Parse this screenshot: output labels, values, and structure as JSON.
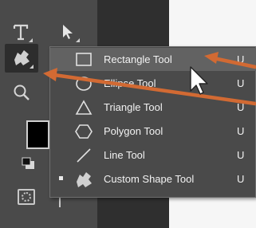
{
  "toolbar": {
    "tools": [
      "type-tool",
      "path-selection-tool",
      "custom-shape-tool",
      "zoom-tool",
      "foreground-color",
      "default-colors",
      "quick-mask",
      "screen-mode"
    ]
  },
  "shape_menu": {
    "items": [
      {
        "label": "Rectangle Tool",
        "shortcut": "U",
        "icon": "rectangle-icon",
        "active": false,
        "highlighted": true
      },
      {
        "label": "Ellipse Tool",
        "shortcut": "U",
        "icon": "ellipse-icon",
        "active": false,
        "highlighted": false
      },
      {
        "label": "Triangle Tool",
        "shortcut": "U",
        "icon": "triangle-icon",
        "active": false,
        "highlighted": false
      },
      {
        "label": "Polygon Tool",
        "shortcut": "U",
        "icon": "polygon-icon",
        "active": false,
        "highlighted": false
      },
      {
        "label": "Line Tool",
        "shortcut": "U",
        "icon": "line-icon",
        "active": false,
        "highlighted": false
      },
      {
        "label": "Custom Shape Tool",
        "shortcut": "U",
        "icon": "custom-shape-icon",
        "active": true,
        "highlighted": false
      }
    ]
  },
  "annotation": {
    "arrow_color": "#d26a33"
  },
  "colors": {
    "toolbar_bg": "#4a4a4a",
    "menu_bg": "#4a4a4a",
    "highlight": "#626262",
    "text": "#f2f2f2"
  }
}
